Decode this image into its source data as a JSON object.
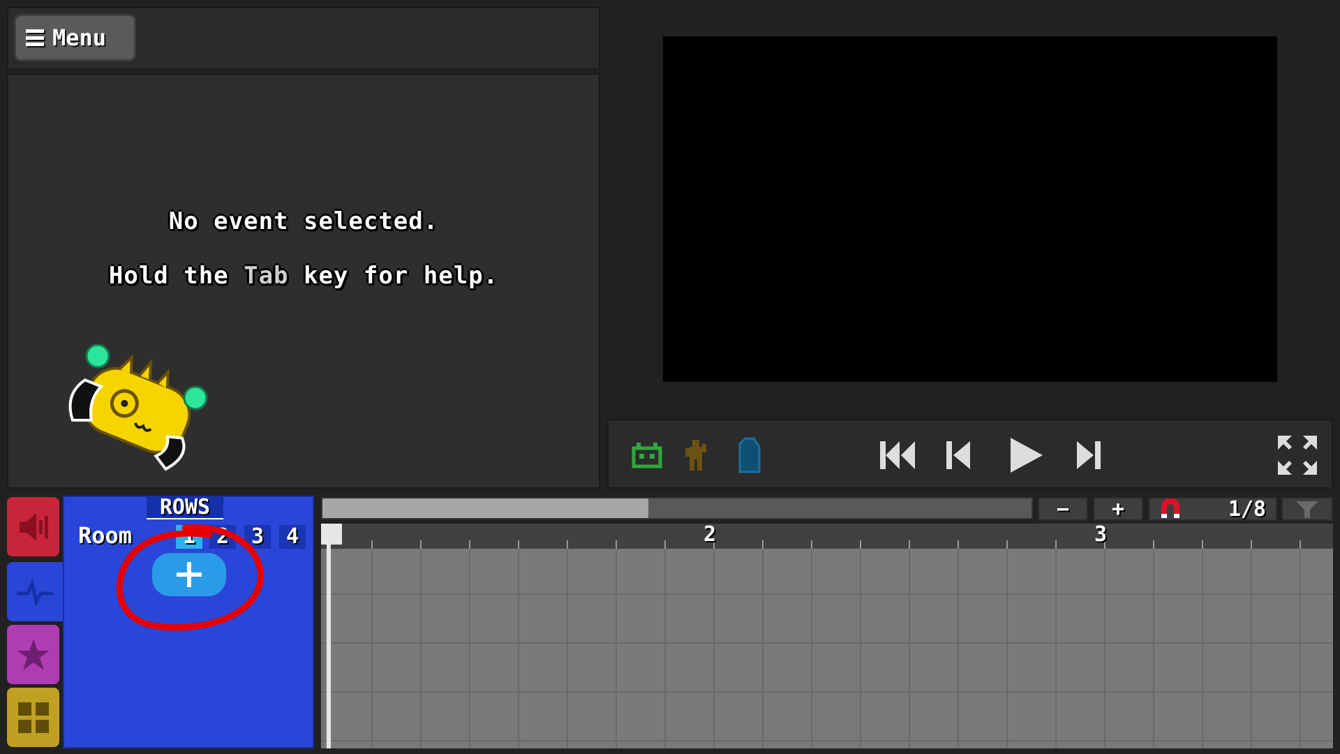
{
  "header": {
    "menu_label": "Menu"
  },
  "event_panel": {
    "message_line1": "No event selected.",
    "message_line2_before": "Hold the ",
    "message_line2_key": "Tab",
    "message_line2_after": " key for help."
  },
  "preview": {
    "controls": [
      "robot-icon",
      "character-icon",
      "ghost-icon",
      "skip-to-start-icon",
      "step-back-icon",
      "play-icon",
      "step-forward-icon",
      "fullscreen-icon"
    ]
  },
  "tabs": [
    "sound",
    "rows",
    "actions",
    "rooms"
  ],
  "rows_panel": {
    "title": "ROWS",
    "room_label": "Room",
    "rooms": [
      "1",
      "2",
      "3",
      "4"
    ],
    "selected_room": "1",
    "add_label": "+"
  },
  "timeline": {
    "zoom_out_label": "−",
    "zoom_in_label": "+",
    "snap_value": "1/8",
    "bar_labels": [
      "2",
      "3"
    ],
    "scroll_position": 0.46
  },
  "colors": {
    "sound_tab": "#c8253a",
    "rows_tab": "#2a46d8",
    "actions_tab": "#b03cb4",
    "rooms_tab": "#c0a020",
    "annotation": "#e60000"
  }
}
